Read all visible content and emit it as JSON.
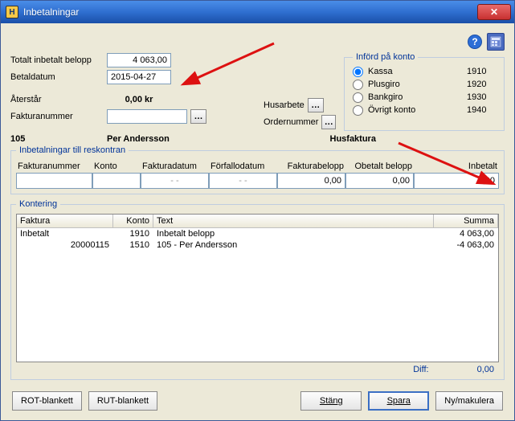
{
  "window": {
    "title": "Inbetalningar"
  },
  "form": {
    "total_label": "Totalt inbetalt belopp",
    "total_value": "4 063,00",
    "betdatum_label": "Betaldatum",
    "betdatum_value": "2015-04-27",
    "aterstar_label": "Återstår",
    "aterstar_value": "0,00 kr",
    "fakturanr_label": "Fakturanummer",
    "fakturanr_value": "",
    "husarbete_label": "Husarbete",
    "husarbete_value": "",
    "ordernr_label": "Ordernummer",
    "ordernr_value": "",
    "row_id": "105",
    "row_name": "Per Andersson",
    "row_type": "Husfaktura"
  },
  "konto": {
    "legend": "Införd på konto",
    "options": [
      {
        "label": "Kassa",
        "code": "1910",
        "checked": true
      },
      {
        "label": "Plusgiro",
        "code": "1920",
        "checked": false
      },
      {
        "label": "Bankgiro",
        "code": "1930",
        "checked": false
      },
      {
        "label": "Övrigt konto",
        "code": "1940",
        "checked": false
      }
    ]
  },
  "resk": {
    "legend": "Inbetalningar till reskontran",
    "headers": {
      "fnr": "Fakturanummer",
      "konto": "Konto",
      "fdatum": "Fakturadatum",
      "forfall": "Förfallodatum",
      "fbelopp": "Fakturabelopp",
      "obelopp": "Obetalt belopp",
      "inbetalt": "Inbetalt"
    },
    "row": {
      "fnr": "",
      "konto": "",
      "fdatum": "-  -",
      "forfall": "-  -",
      "fbelopp": "0,00",
      "obelopp": "0,00",
      "inbetalt": "0,00"
    }
  },
  "kontering": {
    "legend": "Kontering",
    "headers": {
      "faktura": "Faktura",
      "konto": "Konto",
      "text": "Text",
      "summa": "Summa"
    },
    "rows": [
      {
        "faktura": "Inbetalt",
        "konto": "1910",
        "text": "Inbetalt belopp",
        "summa": "4 063,00"
      },
      {
        "faktura": "20000115",
        "konto": "1510",
        "text": "105 - Per Andersson",
        "summa": "-4 063,00"
      }
    ],
    "diff_label": "Diff:",
    "diff_value": "0,00"
  },
  "buttons": {
    "rot": "ROT-blankett",
    "rut": "RUT-blankett",
    "stang": "Stäng",
    "spara": "Spara",
    "nymak": "Ny/makulera"
  }
}
